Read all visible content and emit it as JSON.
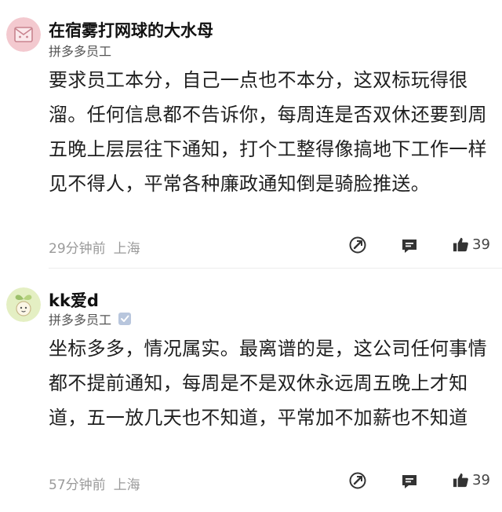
{
  "comments": [
    {
      "username": "在宿雾打网球的大水母",
      "org": "拼多多员工",
      "verified": false,
      "avatar_icon": "envelope-face-avatar",
      "avatar_color": "#f3c9cf",
      "body": "要求员工本分，自己一点也不本分，这双标玩得很溜。任何信息都不告诉你，每周连是否双休还要到周五晚上层层往下通知，打个工整得像搞地下工作一样见不得人，平常各种廉政通知倒是骑脸推送。",
      "time": "29分钟前",
      "location": "上海",
      "likes": "39",
      "icons": [
        "share-icon",
        "comment-icon",
        "thumbs-up-icon"
      ]
    },
    {
      "username": "kk爱d",
      "org": "拼多多员工",
      "verified": true,
      "avatar_icon": "sprout-face-avatar",
      "avatar_color": "#e4efc3",
      "body": "坐标多多，情况属实。最离谱的是，这公司任何事情都不提前通知，每周是不是双休永远周五晚上才知道，五一放几天也不知道，平常加不加薪也不知道",
      "time": "57分钟前",
      "location": "上海",
      "likes": "39",
      "icons": [
        "share-icon",
        "comment-icon",
        "thumbs-up-icon"
      ]
    }
  ]
}
